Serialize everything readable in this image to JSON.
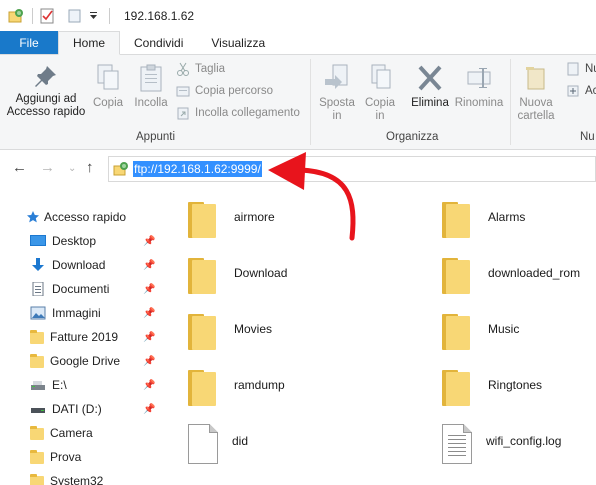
{
  "window": {
    "title": "192.168.1.62"
  },
  "ribbon_tabs": [
    "File",
    "Home",
    "Condividi",
    "Visualizza"
  ],
  "ribbon": {
    "pin_label": "Aggiungi ad\nAccesso rapido",
    "copy_label": "Copia",
    "paste_label": "Incolla",
    "cut_label": "Taglia",
    "copy_path_label": "Copia percorso",
    "paste_shortcut_label": "Incolla collegamento",
    "move_to_label": "Sposta\nin",
    "copy_to_label": "Copia\nin",
    "delete_label": "Elimina",
    "rename_label": "Rinomina",
    "new_folder_label": "Nuova\ncartella",
    "new_item_partial": "Nu",
    "easy_access_partial": "Acc",
    "group_clipboard": "Appunti",
    "group_organize": "Organizza",
    "group_new_partial": "Nu"
  },
  "address": {
    "value": "ftp://192.168.1.62:9999/"
  },
  "nav_pane": {
    "quick_access": "Accesso rapido",
    "items": [
      {
        "label": "Desktop",
        "icon": "desktop-icon",
        "pinned": true
      },
      {
        "label": "Download",
        "icon": "download-icon",
        "pinned": true
      },
      {
        "label": "Documenti",
        "icon": "documents-icon",
        "pinned": true
      },
      {
        "label": "Immagini",
        "icon": "pictures-icon",
        "pinned": true
      },
      {
        "label": "Fatture 2019",
        "icon": "folder-icon",
        "pinned": true
      },
      {
        "label": "Google Drive",
        "icon": "folder-icon",
        "pinned": true
      },
      {
        "label": "E:\\",
        "icon": "drive-icon",
        "pinned": true
      },
      {
        "label": "DATI (D:)",
        "icon": "drive-icon",
        "pinned": true
      },
      {
        "label": "Camera",
        "icon": "folder-icon",
        "pinned": false
      },
      {
        "label": "Prova",
        "icon": "folder-icon",
        "pinned": false
      },
      {
        "label": "System32",
        "icon": "folder-icon",
        "pinned": false
      }
    ]
  },
  "files": [
    {
      "name": "airmore",
      "type": "folder"
    },
    {
      "name": "Alarms",
      "type": "folder"
    },
    {
      "name": "Download",
      "type": "folder"
    },
    {
      "name": "downloaded_rom",
      "type": "folder"
    },
    {
      "name": "Movies",
      "type": "folder"
    },
    {
      "name": "Music",
      "type": "folder"
    },
    {
      "name": "ramdump",
      "type": "folder"
    },
    {
      "name": "Ringtones",
      "type": "folder"
    },
    {
      "name": "did",
      "type": "file"
    },
    {
      "name": "wifi_config.log",
      "type": "text-file"
    }
  ],
  "colors": {
    "accent": "#1979ca",
    "selection": "#3390ff",
    "folder": "#f8d775",
    "annotation": "#e8141c"
  }
}
